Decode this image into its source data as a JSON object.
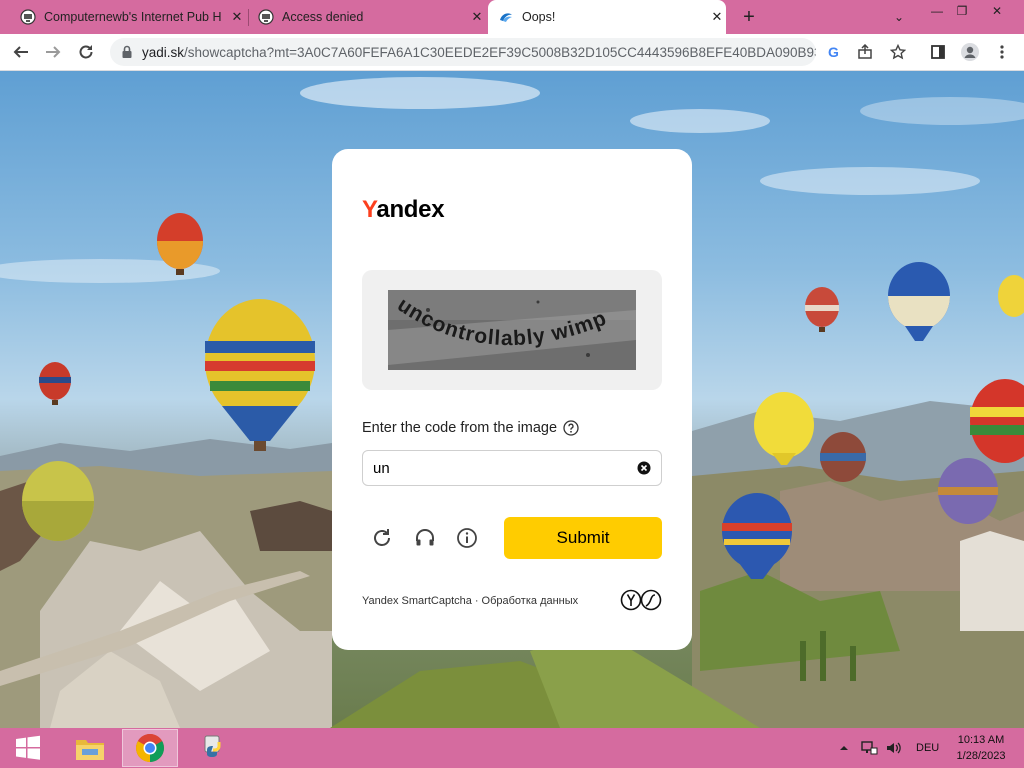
{
  "tabs": [
    {
      "title": "Computernewb's Internet Pub H",
      "favicon": "computernewb-icon"
    },
    {
      "title": "Access denied",
      "favicon": "computernewb-icon"
    },
    {
      "title": "Oops!",
      "favicon": "yandex-disk-icon",
      "active": true
    }
  ],
  "address": {
    "domain": "yadi.sk",
    "path": "/showcaptcha?mt=3A0C7A60FEFA6A1C30EEDE2EF39C5008B32D105CC4443596B8EFE40BDA090B93..."
  },
  "card": {
    "logo_first": "Y",
    "logo_rest": "andex",
    "captcha_text": "uncontrollably wimp",
    "prompt": "Enter the code from the image",
    "input_value": "un",
    "submit_label": "Submit",
    "footer_brand": "Yandex SmartCaptcha",
    "footer_sep": "·",
    "footer_link": "Обработка данных"
  },
  "tray": {
    "language": "DEU",
    "time": "10:13 AM",
    "date": "1/28/2023"
  },
  "colors": {
    "tab_bar": "#d56b9f",
    "taskbar": "#d56b9f",
    "submit": "#ffcc00",
    "logo_accent": "#fc3f1d"
  }
}
